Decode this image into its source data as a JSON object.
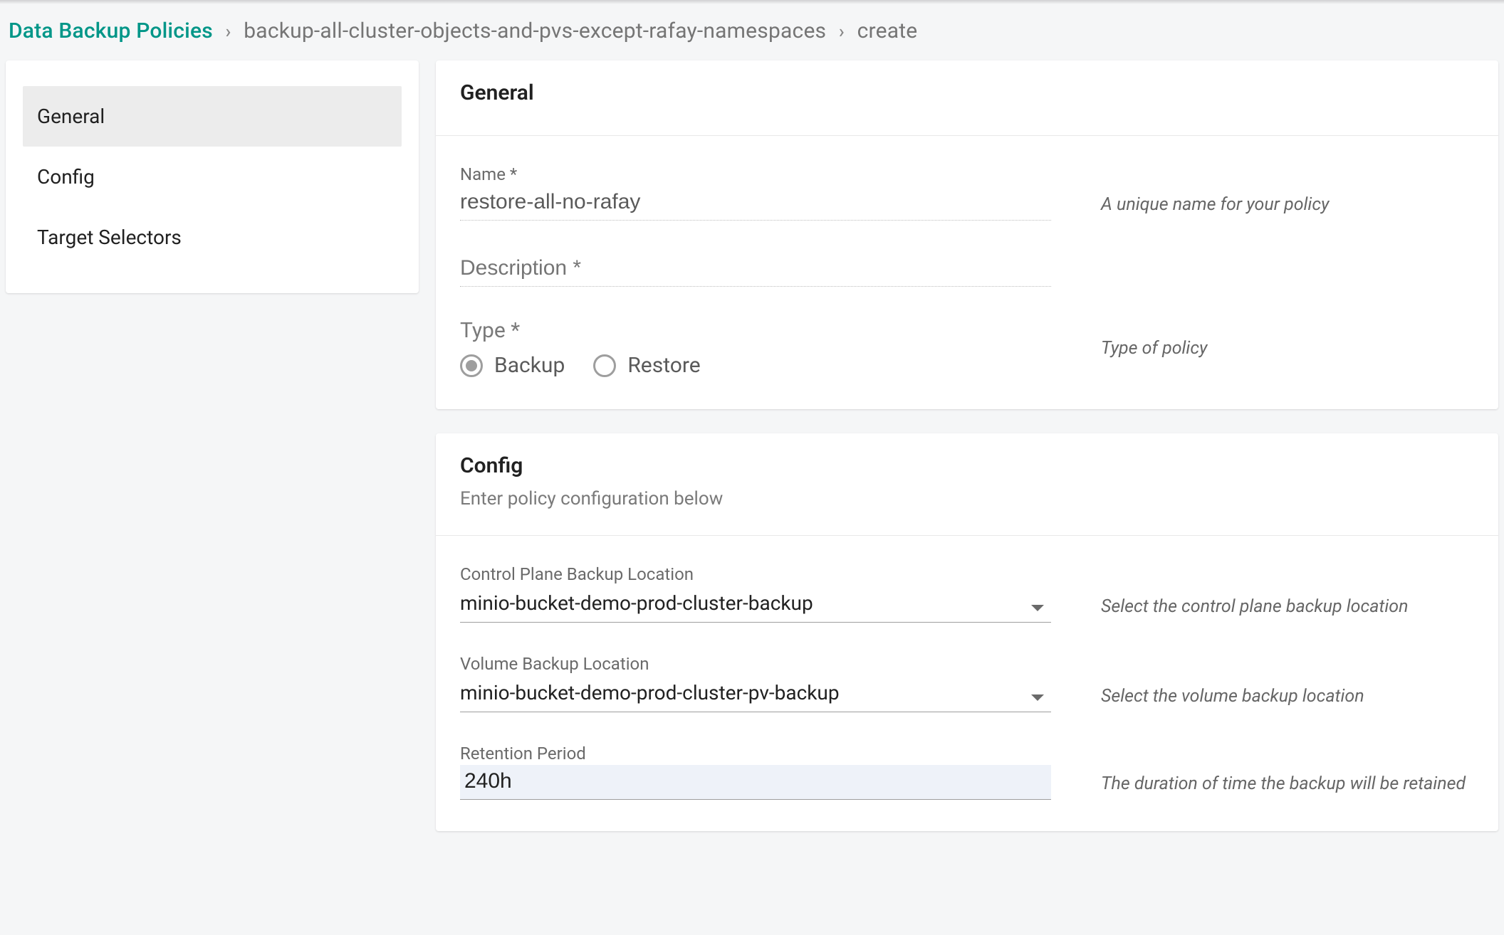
{
  "breadcrumb": {
    "root": "Data Backup Policies",
    "item": "backup-all-cluster-objects-and-pvs-except-rafay-namespaces",
    "leaf": "create"
  },
  "sidebar": {
    "items": [
      {
        "label": "General",
        "active": true
      },
      {
        "label": "Config",
        "active": false
      },
      {
        "label": "Target Selectors",
        "active": false
      }
    ]
  },
  "general": {
    "title": "General",
    "name": {
      "label": "Name *",
      "value": "restore-all-no-rafay",
      "helper": "A unique name for your policy"
    },
    "description": {
      "label": "Description *",
      "value": ""
    },
    "type": {
      "label": "Type *",
      "helper": "Type of policy",
      "options": [
        {
          "label": "Backup",
          "selected": true
        },
        {
          "label": "Restore",
          "selected": false
        }
      ]
    }
  },
  "config": {
    "title": "Config",
    "subtitle": "Enter policy configuration below",
    "control_plane": {
      "label": "Control Plane Backup Location",
      "value": "minio-bucket-demo-prod-cluster-backup",
      "helper": "Select the control plane backup location"
    },
    "volume": {
      "label": "Volume Backup Location",
      "value": "minio-bucket-demo-prod-cluster-pv-backup",
      "helper": "Select the volume backup location"
    },
    "retention": {
      "label": "Retention Period",
      "value": "240h",
      "helper": "The duration of time the backup will be retained"
    }
  }
}
